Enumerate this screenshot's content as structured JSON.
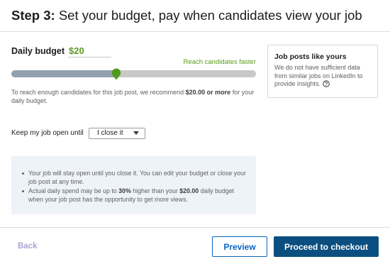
{
  "header": {
    "step_label": "Step 3:",
    "title": "Set your budget, pay when candidates view your job"
  },
  "budget": {
    "label": "Daily budget",
    "value": "$20",
    "reach_hint": "Reach candidates faster",
    "slider_level": 0.43,
    "recommend_prefix": "To reach enough candidates for this job post, we recommend",
    "recommend_amount": "$20.00 or more",
    "recommend_suffix": "for your daily budget."
  },
  "sidebox": {
    "title": "Job posts like yours",
    "text": "We do not have sufficient data from similar jobs on LinkedIn to provide insights.",
    "icon": "help-circle-icon"
  },
  "keep_open": {
    "label": "Keep my job open until",
    "selected": "I close it",
    "icon": "chevron-down-icon"
  },
  "info": {
    "item1": "Your job will stay open until you close it. You can edit your budget or close your job post at any time.",
    "item2_prefix": "Actual daily spend may be up to",
    "item2_percent": "30%",
    "item2_middle": "higher than your",
    "item2_amount": "$20.00",
    "item2_suffix": "daily budget when your job post has the opportunity to get more views."
  },
  "footer": {
    "back_label": "Back",
    "preview_label": "Preview",
    "checkout_label": "Proceed to checkout"
  },
  "colors": {
    "accent_green": "#5a9a1e",
    "primary_blue": "#0a66c2",
    "checkout_bg": "#0a4f80",
    "back_text": "#a9a4d6",
    "info_bg": "#eef3f8",
    "slider_fill": "#93a1ae",
    "thumb_green": "#4f9a1a"
  }
}
